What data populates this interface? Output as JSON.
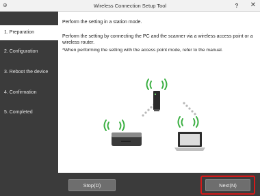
{
  "window": {
    "title": "Wireless Connection Setup Tool",
    "app_icon": "⊕",
    "help": "?",
    "close": "✕"
  },
  "sidebar": {
    "steps": [
      {
        "label": "1. Preparation",
        "active": true
      },
      {
        "label": "2. Configuration",
        "active": false
      },
      {
        "label": "3. Reboot the device",
        "active": false
      },
      {
        "label": "4. Confirmation",
        "active": false
      },
      {
        "label": "5. Completed",
        "active": false
      }
    ]
  },
  "main": {
    "line1": "Perform the setting in a station mode.",
    "line2": "Perform the setting by connecting the PC and the scanner via a wireless access point or a wireless router.",
    "line3": "*When performing the setting with the access point mode, refer to the manual."
  },
  "footer": {
    "stop_label": "Stop(D)",
    "next_label": "Next(N)"
  },
  "colors": {
    "sidebar_bg": "#3b3b3b",
    "wifi_green": "#3cb043",
    "highlight_red": "#d41a1a"
  },
  "icons": {
    "router": "router-icon",
    "scanner": "scanner-icon",
    "laptop": "laptop-icon",
    "wifi": "wifi-signal-icon"
  }
}
